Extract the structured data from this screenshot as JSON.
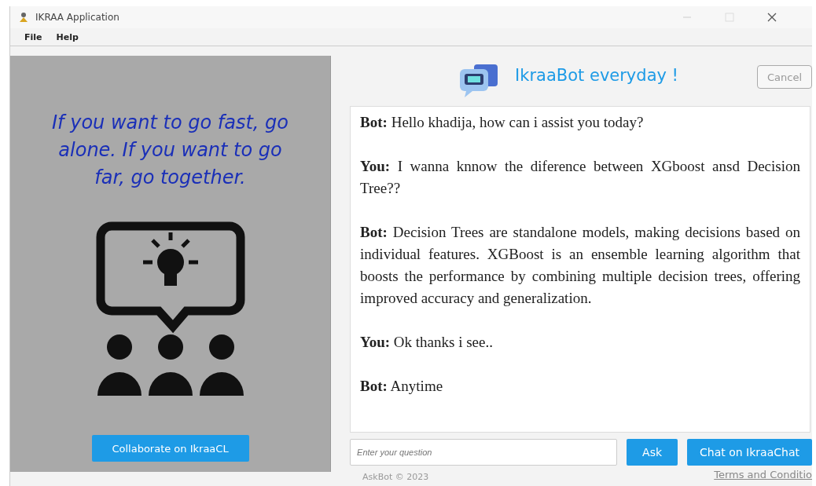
{
  "window": {
    "title": "IKRAA Application"
  },
  "menu": [
    "File",
    "Help"
  ],
  "left_panel": {
    "quote": "If you want to go fast, go alone. If you want to go far, go together.",
    "button": "Collaborate on IkraaCL"
  },
  "header": {
    "title": "IkraaBot everyday !",
    "cancel": "Cancel"
  },
  "messages": [
    {
      "speaker": "Bot:",
      "text": "Hello khadija, how can i assist you today?"
    },
    {
      "speaker": "You:",
      "text": "I wanna knnow the diference between XGboost ansd Decision Tree??"
    },
    {
      "speaker": "Bot:",
      "text": "Decision Trees are standalone models, making decisions based on individual features. XGBoost is an ensemble learning algorithm that boosts the performance by combining multiple decision trees, offering improved accuracy and generalization."
    },
    {
      "speaker": "You:",
      "text": "Ok thanks i see.."
    },
    {
      "speaker": "Bot:",
      "text": "Anytime"
    }
  ],
  "question": {
    "placeholder": "Enter your question"
  },
  "buttons": {
    "ask": "Ask",
    "chat": "Chat on IkraaChat"
  },
  "footer": {
    "copyright": "AskBot © 2023",
    "link": "Terms and Conditio"
  }
}
